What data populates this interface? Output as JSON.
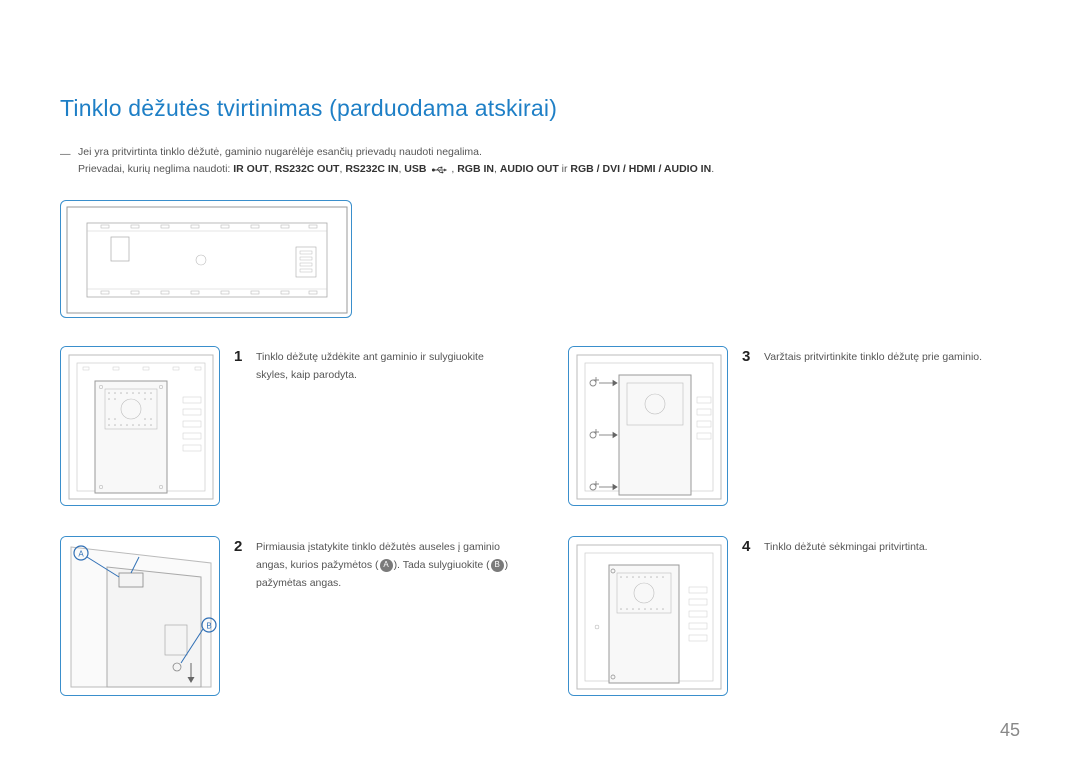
{
  "title": "Tinklo dėžutės tvirtinimas (parduodama atskirai)",
  "note": {
    "dash": "―",
    "line1": "Jei yra pritvirtinta tinklo dėžutė, gaminio nugarėlėje esančių prievadų naudoti negalima.",
    "line2_prefix": "Prievadai, kurių neglima naudoti: ",
    "ports_a": "IR OUT",
    "sep": ", ",
    "ports_b": "RS232C OUT",
    "ports_c": "RS232C IN",
    "ports_d": "USB",
    "ports_e": "RGB IN",
    "ports_f": "AUDIO OUT",
    "ir": " ir ",
    "ports_g": "RGB / DVI / HDMI / AUDIO IN",
    "period": "."
  },
  "steps": {
    "s1": {
      "num": "1",
      "text": "Tinklo dėžutę uždėkite ant gaminio ir sulygiuokite skyles, kaip parodyta."
    },
    "s2": {
      "num": "2",
      "p1": "Pirmiausia įstatykite tinklo dėžutės auseles į gaminio angas, kurios pažymėtos (",
      "A": "A",
      "p2": "). Tada sulygiuokite (",
      "B": "B",
      "p3": ") pažymėtas angas."
    },
    "s3": {
      "num": "3",
      "text": "Varžtais pritvirtinkite tinklo dėžutę prie gaminio."
    },
    "s4": {
      "num": "4",
      "text": "Tinklo dėžutė sėkmingai pritvirtinta."
    }
  },
  "labels": {
    "A": "A",
    "B": "B"
  },
  "page": "45"
}
